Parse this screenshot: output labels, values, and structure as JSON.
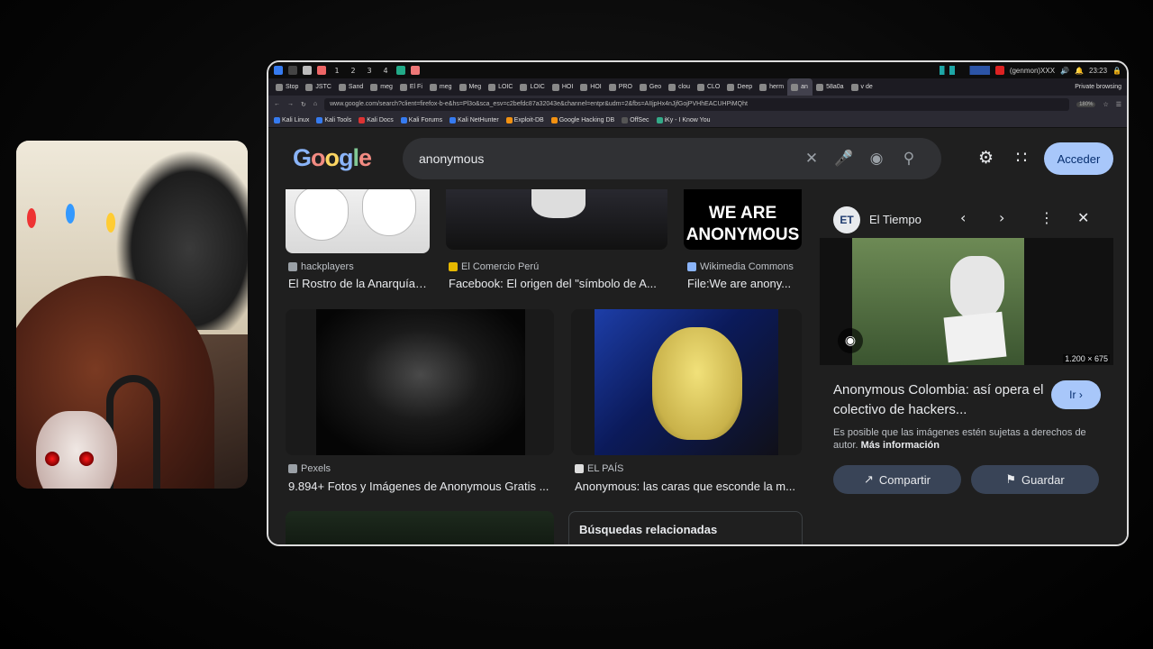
{
  "taskbar": {
    "workspaces": [
      "1",
      "2",
      "3",
      "4"
    ],
    "user": "(genmon)XXX",
    "clock": "23:23"
  },
  "tabs": [
    {
      "label": "Stop"
    },
    {
      "label": "JSTC"
    },
    {
      "label": "Sand"
    },
    {
      "label": "meg"
    },
    {
      "label": "El Fi"
    },
    {
      "label": "meg"
    },
    {
      "label": "Meg"
    },
    {
      "label": "LOIC"
    },
    {
      "label": "LOIC"
    },
    {
      "label": "HOI"
    },
    {
      "label": "HOI"
    },
    {
      "label": "PRO"
    },
    {
      "label": "Geo"
    },
    {
      "label": "clou"
    },
    {
      "label": "CLO"
    },
    {
      "label": "Deep"
    },
    {
      "label": "herm"
    },
    {
      "label": "an",
      "active": true
    },
    {
      "label": "58a0a"
    },
    {
      "label": "v de"
    }
  ],
  "private_label": "Private browsing",
  "address": {
    "url": "www.google.com/search?client=firefox-b-e&hs=Pl3o&sca_esv=c2befdc87a32043e&channel=entpr&udm=2&fbs=AIIjpHx4nJjfGojPVHhEACUHPiMQht",
    "zoom": "180%"
  },
  "bookmarks": [
    {
      "label": "Kali Linux",
      "color": "#367bf0"
    },
    {
      "label": "Kali Tools",
      "color": "#367bf0"
    },
    {
      "label": "Kali Docs",
      "color": "#d33"
    },
    {
      "label": "Kali Forums",
      "color": "#367bf0"
    },
    {
      "label": "Kali NetHunter",
      "color": "#367bf0"
    },
    {
      "label": "Exploit-DB",
      "color": "#f29111"
    },
    {
      "label": "Google Hacking DB",
      "color": "#f29111"
    },
    {
      "label": "OffSec",
      "color": "#555"
    },
    {
      "label": "iKy - I Know You",
      "color": "#3a8"
    }
  ],
  "google": {
    "logo": "Google",
    "query": "anonymous",
    "signin": "Acceder"
  },
  "results": [
    {
      "source": "hackplayers",
      "title": "El Rostro de la Anarquía ..."
    },
    {
      "source": "El Comercio Perú",
      "title": "Facebook: El origen del \"símbolo de A..."
    },
    {
      "source": "Wikimedia Commons",
      "title": "File:We are anony..."
    },
    {
      "source": "Pexels",
      "title": "9.894+ Fotos y Imágenes de Anonymous Gratis ..."
    },
    {
      "source": "EL PAÍS",
      "title": "Anonymous: las caras que esconde la m..."
    }
  ],
  "we_are_text": "WE ARE",
  "anonymous_text": "ANONYMOUS",
  "related_title": "Búsquedas relacionadas",
  "panel": {
    "badge": "ET",
    "source": "El Tiempo",
    "dims": "1.200 × 675",
    "title": "Anonymous Colombia: así opera el colectivo de hackers...",
    "go": "Ir",
    "note": "Es posible que las imágenes estén sujetas a derechos de autor.",
    "more": "Más información",
    "share": "Compartir",
    "save": "Guardar"
  },
  "colors": {
    "accent": "#a8c7fa",
    "background": "#1f1f1f",
    "search_bg": "#303134"
  }
}
